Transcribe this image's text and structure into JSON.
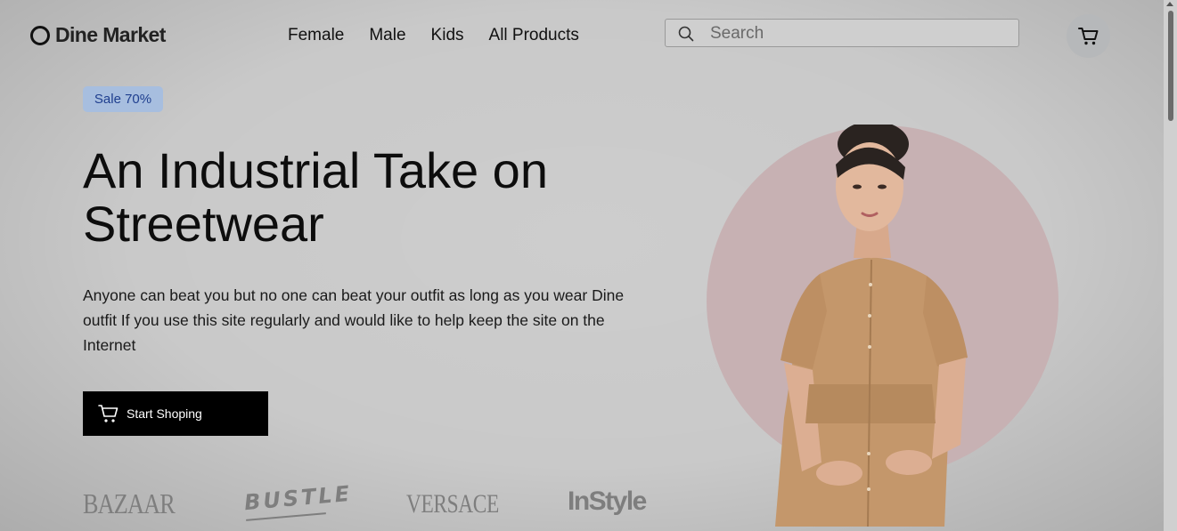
{
  "header": {
    "logo_text": "Dine Market",
    "nav": [
      {
        "label": "Female"
      },
      {
        "label": "Male"
      },
      {
        "label": "Kids"
      },
      {
        "label": "All Products"
      }
    ],
    "search_placeholder": "Search",
    "search_icon": "search-icon",
    "cart_icon": "cart-icon"
  },
  "hero": {
    "badge": "Sale 70%",
    "headline": "An Industrial Take on Streetwear",
    "description": "Anyone can beat you but no one can beat your outfit as long as you wear Dine outfit If you use this site regularly and would like to help keep the site on the Internet",
    "cta_label": "Start Shoping",
    "cta_icon": "cart-icon",
    "image_alt": "Model in tan belted shirt dress"
  },
  "brands": [
    "BAZAAR",
    "BUSTLE",
    "VERSACE",
    "InStyle"
  ],
  "colors": {
    "badge_bg": "#a7bedf",
    "badge_text": "#1f3f8f",
    "cta_bg": "#000000",
    "circle_bg": "#c7b1b3",
    "page_bg": "#c9c9c9"
  }
}
